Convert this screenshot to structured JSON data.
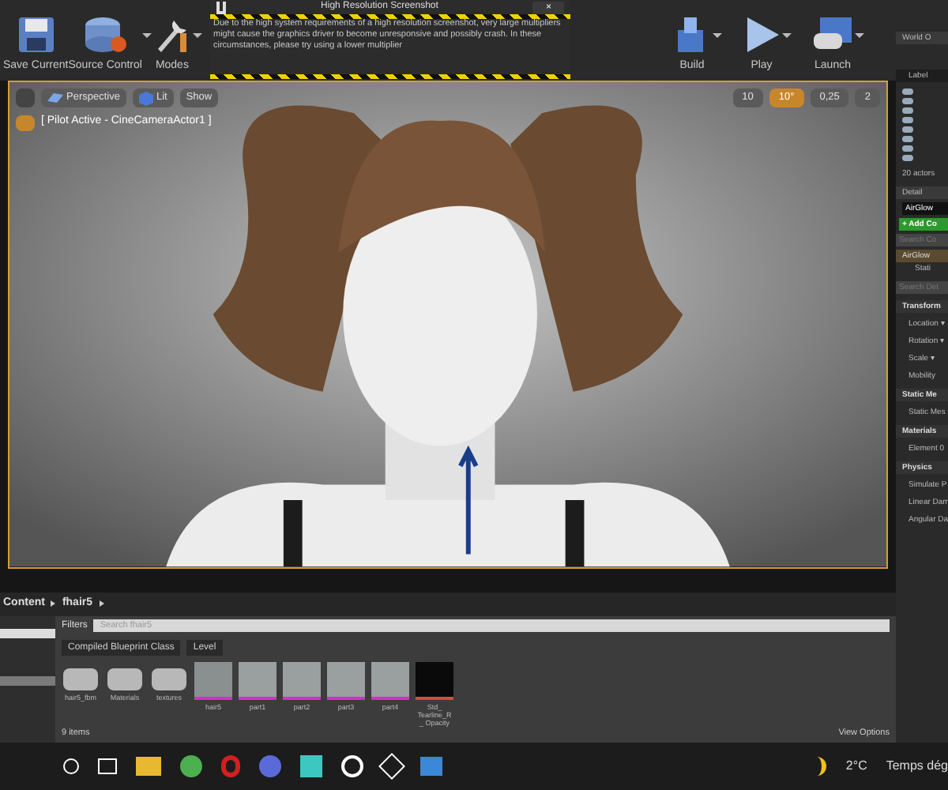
{
  "toolbar": {
    "buttons": [
      {
        "label": "Save Current",
        "kind": "save",
        "dropdown": false
      },
      {
        "label": "Source Control",
        "kind": "source",
        "dropdown": true
      },
      {
        "label": "Modes",
        "kind": "modes",
        "dropdown": true
      }
    ],
    "buttons_right": [
      {
        "label": "Build",
        "kind": "build",
        "dropdown": true
      },
      {
        "label": "Play",
        "kind": "play",
        "dropdown": true
      },
      {
        "label": "Launch",
        "kind": "launch",
        "dropdown": true
      }
    ]
  },
  "dialog": {
    "title": "High Resolution Screenshot",
    "close": "×",
    "message": "Due to the high system requirements of a high resolution screenshot, very large multipliers might cause the graphics driver to become unresponsive and possibly crash. In these circumstances, please try using a lower multiplier"
  },
  "viewport": {
    "buttons": [
      {
        "label": "Perspective",
        "kind": "perspective"
      },
      {
        "label": "Lit",
        "kind": "lit"
      },
      {
        "label": "Show",
        "kind": "show"
      }
    ],
    "snaps": [
      {
        "value": "10",
        "selected": false
      },
      {
        "value": "10°",
        "selected": true
      },
      {
        "value": "0,25",
        "selected": false
      },
      {
        "value": "2",
        "selected": false
      }
    ],
    "pilot": "[ Pilot Active - CineCameraActor1 ]"
  },
  "outliner": {
    "title": "World O",
    "column": "Label",
    "count": "20 actors"
  },
  "details": {
    "title": "Detail",
    "actor": "AirGlow",
    "add": "+ Add Co",
    "search_components": "Search Co",
    "component": "AirGlow",
    "sub_component": "Stati",
    "search_details": "Search Det",
    "sections": [
      {
        "title": "Transform",
        "rows": [
          "Location ▾",
          "Rotation ▾",
          "Scale ▾",
          "Mobility"
        ]
      },
      {
        "title": "Static Me",
        "rows": [
          "Static Mes"
        ]
      },
      {
        "title": "Materials",
        "rows": [
          "Element 0"
        ]
      },
      {
        "title": "Physics",
        "rows": [
          "Simulate P",
          "Linear Dam",
          "Angular Da"
        ]
      }
    ]
  },
  "content_browser": {
    "path": [
      "Content",
      "fhair5"
    ],
    "filters": "Filters",
    "search_placeholder": "Search fhair5",
    "chips": [
      "Compiled Blueprint Class",
      "Level"
    ],
    "assets": [
      {
        "name": "hair5_fbm",
        "kind": "folder"
      },
      {
        "name": "Materials",
        "kind": "folder"
      },
      {
        "name": "textures",
        "kind": "folder"
      },
      {
        "name": "hair5",
        "kind": "mesh"
      },
      {
        "name": "part1",
        "kind": "level"
      },
      {
        "name": "part2",
        "kind": "level"
      },
      {
        "name": "part3",
        "kind": "level"
      },
      {
        "name": "part4",
        "kind": "level"
      },
      {
        "name": "Std_ Tearline_R_ Opacity",
        "kind": "material"
      }
    ],
    "count": "9 items",
    "view_options": "View Options"
  },
  "taskbar": {
    "weather": "2°C",
    "weather_text": "Temps dég"
  }
}
